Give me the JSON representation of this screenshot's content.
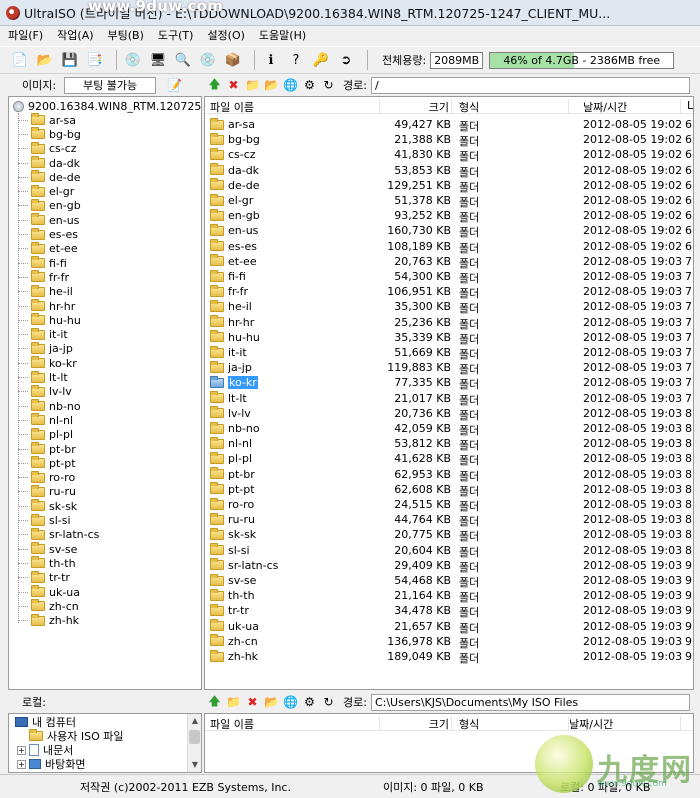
{
  "window": {
    "title": "UltraISO (트라이얼 버전) - E:\\TDDOWNLOAD\\9200.16384.WIN8_RTM.120725-1247_CLIENT_MU...",
    "watermark": "www.9duw.com"
  },
  "menu": [
    "파일(F)",
    "작업(A)",
    "부팅(B)",
    "도구(T)",
    "설정(O)",
    "도움말(H)"
  ],
  "toolbar": {
    "icons": [
      "new-icon",
      "open-icon",
      "save-icon",
      "save-as-icon",
      "burn-icon",
      "mount-icon",
      "extract-icon",
      "make-image-icon",
      "compress-icon",
      "info-icon",
      "help-icon",
      "register-icon",
      "exit-icon"
    ],
    "capacity_label": "전체용량:",
    "capacity_value": "2089MB",
    "capacity_percent": 46,
    "capacity_text": "46% of 4.7GB - 2386MB free"
  },
  "image_pane": {
    "label": "이미지:",
    "boot_status": "부팅 불가능",
    "path_label": "경로:",
    "path_value": "/"
  },
  "image_tree": {
    "root": "9200.16384.WIN8_RTM.120725-124",
    "folders": [
      "ar-sa",
      "bg-bg",
      "cs-cz",
      "da-dk",
      "de-de",
      "el-gr",
      "en-gb",
      "en-us",
      "es-es",
      "et-ee",
      "fi-fi",
      "fr-fr",
      "he-il",
      "hr-hr",
      "hu-hu",
      "it-it",
      "ja-jp",
      "ko-kr",
      "lt-lt",
      "lv-lv",
      "nb-no",
      "nl-nl",
      "pl-pl",
      "pt-br",
      "pt-pt",
      "ro-ro",
      "ru-ru",
      "sk-sk",
      "sl-si",
      "sr-latn-cs",
      "sv-se",
      "th-th",
      "tr-tr",
      "uk-ua",
      "zh-cn",
      "zh-hk"
    ]
  },
  "file_list": {
    "columns": [
      "파일 이름",
      "크기",
      "형식",
      "날짜/시간",
      "L"
    ],
    "type_label": "폴더",
    "selected": "ko-kr",
    "rows": [
      {
        "name": "ar-sa",
        "size": "49,427 KB",
        "date": "2012-08-05 19:02",
        "extra": "6"
      },
      {
        "name": "bg-bg",
        "size": "21,388 KB",
        "date": "2012-08-05 19:02",
        "extra": "6"
      },
      {
        "name": "cs-cz",
        "size": "41,830 KB",
        "date": "2012-08-05 19:02",
        "extra": "6"
      },
      {
        "name": "da-dk",
        "size": "53,853 KB",
        "date": "2012-08-05 19:02",
        "extra": "6"
      },
      {
        "name": "de-de",
        "size": "129,251 KB",
        "date": "2012-08-05 19:02",
        "extra": "6"
      },
      {
        "name": "el-gr",
        "size": "51,378 KB",
        "date": "2012-08-05 19:02",
        "extra": "6"
      },
      {
        "name": "en-gb",
        "size": "93,252 KB",
        "date": "2012-08-05 19:02",
        "extra": "6"
      },
      {
        "name": "en-us",
        "size": "160,730 KB",
        "date": "2012-08-05 19:02",
        "extra": "6"
      },
      {
        "name": "es-es",
        "size": "108,189 KB",
        "date": "2012-08-05 19:02",
        "extra": "6"
      },
      {
        "name": "et-ee",
        "size": "20,763 KB",
        "date": "2012-08-05 19:03",
        "extra": "7"
      },
      {
        "name": "fi-fi",
        "size": "54,300 KB",
        "date": "2012-08-05 19:03",
        "extra": "7"
      },
      {
        "name": "fr-fr",
        "size": "106,951 KB",
        "date": "2012-08-05 19:03",
        "extra": "7"
      },
      {
        "name": "he-il",
        "size": "35,300 KB",
        "date": "2012-08-05 19:03",
        "extra": "7"
      },
      {
        "name": "hr-hr",
        "size": "25,236 KB",
        "date": "2012-08-05 19:03",
        "extra": "7"
      },
      {
        "name": "hu-hu",
        "size": "35,339 KB",
        "date": "2012-08-05 19:03",
        "extra": "7"
      },
      {
        "name": "it-it",
        "size": "51,669 KB",
        "date": "2012-08-05 19:03",
        "extra": "7"
      },
      {
        "name": "ja-jp",
        "size": "119,883 KB",
        "date": "2012-08-05 19:03",
        "extra": "7"
      },
      {
        "name": "ko-kr",
        "size": "77,335 KB",
        "date": "2012-08-05 19:03",
        "extra": "7"
      },
      {
        "name": "lt-lt",
        "size": "21,017 KB",
        "date": "2012-08-05 19:03",
        "extra": "7"
      },
      {
        "name": "lv-lv",
        "size": "20,736 KB",
        "date": "2012-08-05 19:03",
        "extra": "8"
      },
      {
        "name": "nb-no",
        "size": "42,059 KB",
        "date": "2012-08-05 19:03",
        "extra": "8"
      },
      {
        "name": "nl-nl",
        "size": "53,812 KB",
        "date": "2012-08-05 19:03",
        "extra": "8"
      },
      {
        "name": "pl-pl",
        "size": "41,628 KB",
        "date": "2012-08-05 19:03",
        "extra": "8"
      },
      {
        "name": "pt-br",
        "size": "62,953 KB",
        "date": "2012-08-05 19:03",
        "extra": "8"
      },
      {
        "name": "pt-pt",
        "size": "62,608 KB",
        "date": "2012-08-05 19:03",
        "extra": "8"
      },
      {
        "name": "ro-ro",
        "size": "24,515 KB",
        "date": "2012-08-05 19:03",
        "extra": "8"
      },
      {
        "name": "ru-ru",
        "size": "44,764 KB",
        "date": "2012-08-05 19:03",
        "extra": "8"
      },
      {
        "name": "sk-sk",
        "size": "20,775 KB",
        "date": "2012-08-05 19:03",
        "extra": "8"
      },
      {
        "name": "sl-si",
        "size": "20,604 KB",
        "date": "2012-08-05 19:03",
        "extra": "8"
      },
      {
        "name": "sr-latn-cs",
        "size": "29,409 KB",
        "date": "2012-08-05 19:03",
        "extra": "9"
      },
      {
        "name": "sv-se",
        "size": "54,468 KB",
        "date": "2012-08-05 19:03",
        "extra": "9"
      },
      {
        "name": "th-th",
        "size": "21,164 KB",
        "date": "2012-08-05 19:03",
        "extra": "9"
      },
      {
        "name": "tr-tr",
        "size": "34,478 KB",
        "date": "2012-08-05 19:03",
        "extra": "9"
      },
      {
        "name": "uk-ua",
        "size": "21,657 KB",
        "date": "2012-08-05 19:03",
        "extra": "9"
      },
      {
        "name": "zh-cn",
        "size": "136,978 KB",
        "date": "2012-08-05 19:03",
        "extra": "9"
      },
      {
        "name": "zh-hk",
        "size": "189,049 KB",
        "date": "2012-08-05 19:03",
        "extra": "9"
      }
    ]
  },
  "local_pane": {
    "label": "로컬:",
    "path_label": "경로:",
    "path_value": "C:\\Users\\KJS\\Documents\\My ISO Files",
    "tree": [
      "내 컴퓨터",
      "사용자 ISO 파일",
      "내문서",
      "바탕화면"
    ],
    "columns": [
      "파일 이름",
      "크기",
      "형식",
      "날짜/시간"
    ]
  },
  "status": {
    "copyright": "저작권 (c)2002-2011 EZB Systems, Inc.",
    "image_count": "이미지: 0 파일, 0 KB",
    "local_count": "로컬: 0 파일, 0 KB"
  },
  "corner_watermark": {
    "text": "九度网",
    "url": "www.9duw.com"
  }
}
